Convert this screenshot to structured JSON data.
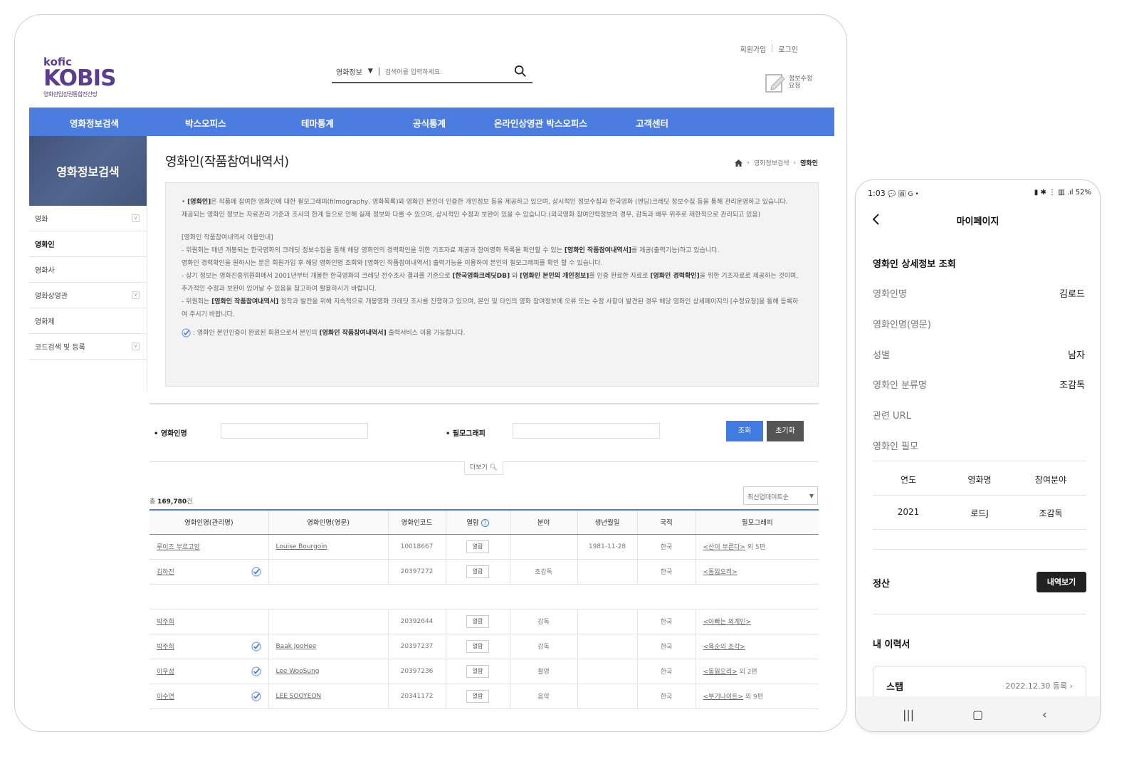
{
  "tablet": {
    "logo": {
      "brand": "kofic",
      "name": "KOBIS",
      "sub": "영화관입장권통합전산망"
    },
    "search": {
      "category": "영화정보",
      "placeholder": "검색어를 입력하세요."
    },
    "top_links": {
      "join": "회원가입",
      "login": "로그인"
    },
    "edit_request": "정보수정 요청",
    "gnb": [
      "영화정보검색",
      "박스오피스",
      "테마통계",
      "공식통계",
      "온라인상영관 박스오피스",
      "고객센터"
    ],
    "lnb": {
      "title": "영화정보검색",
      "items": [
        {
          "label": "영화",
          "chev": true
        },
        {
          "label": "영화인",
          "chev": false
        },
        {
          "label": "영화사",
          "chev": false
        },
        {
          "label": "영화상영관",
          "chev": true
        },
        {
          "label": "영화제",
          "chev": false
        },
        {
          "label": "코드검색 및 등록",
          "chev": true
        }
      ]
    },
    "page_title": "영화인(작품참여내역서)",
    "breadcrumb": {
      "level1": "영화정보검색",
      "current": "영화인"
    },
    "info": {
      "p1_b": "[영화인]",
      "p1": "은 작품에 참여한 영화인에 대한 필모그래피(filmography, 영화목록)와 영화인 본인이 인증한 개인정보 등을 제공하고 있으며, 상시적인 정보수집과 한국영화 (엔딩)크레딧 정보수집 등을 통해 관리운영하고 있습니다.",
      "p2": "제공되는 영화인 정보는 자료관리 기준과 조사의 한계 등으로 인해 실제 정보와 다를 수 있으며, 상시적인 수정과 보완이 있을 수 있습니다.(외국영화 참여인력정보의 경우, 감독과 배우 위주로 제한적으로 관리되고 있음)",
      "p3": "[영화인 작품참여내역서 이용안내]",
      "p4a": "위원회는 매년 개봉되는 한국영화의 크레딧 정보수집을 통해 해당 영화인의 경력확인을 위한 기초자료 제공과 참여영화 목록을 확인할 수 있는 ",
      "p4b": "[영화인 작품참여내역서]",
      "p4c": "를 제공(출력기능)하고 있습니다.",
      "p5": "영화인 경력확인을 원하시는 분은 회원가입 후 해당 영화인명 조회와 [영화인 작품참여내역서] 출력기능을 이용하여 본인의 필모그래피를 확인 할 수 있습니다.",
      "p6a": "상기 정보는 영화진흥위원회에서 2001년부터 개봉한 한국영화의 크레딧 전수조사 결과를 기준으로 ",
      "p6b": "[한국영화크레딧DB]",
      "p6c": " 와 ",
      "p6d": "[영화인 본인의 개인정보]",
      "p6e": "를 인증 완료한 자료로 ",
      "p6f": "[영화인 경력확인]",
      "p6g": "을 위한 기초자료로 제공하는 것이며, 추가적인 수정과 보완이 있어날 수 있음을 참고하여 활용하시기 바랍니다.",
      "p7a": "위원회는 ",
      "p7b": "[영화인 작품참여내역서]",
      "p7c": " 정착과 발전을 위해 지속적으로 개봉영화 크레딧 조사를 진행하고 있으며, 본인 및 타인의 영화 참여정보에 오류 또는 수정 사항이 발견된 경우 해당 영화인 상세페이지의 [수정요청]을 통해 등록하여 주시기 바랍니다.",
      "p8a": ": 영화인 본인인증이 완료된 회원으로서 본인의 ",
      "p8b": "[영화인 작품참여내역서]",
      "p8c": " 출력서비스 이용 가능합니다."
    },
    "filter": {
      "name_label": "영화인명",
      "filmo_label": "필모그래피",
      "search_btn": "조회",
      "reset_btn": "초기화",
      "more": "더보기"
    },
    "total": {
      "prefix": "총 ",
      "count": "169,780",
      "suffix": "건"
    },
    "sort": "최신업데이트순",
    "table": {
      "headers": [
        "영화인명(관리명)",
        "영화인명(영문)",
        "영화인코드",
        "열람",
        "분야",
        "생년월일",
        "국적",
        "필모그래피"
      ],
      "view_label": "열람",
      "rows": [
        {
          "name": "루이즈 부르고앙",
          "verified": false,
          "en": "Louise Bourgoin",
          "code": "10018667",
          "field": "",
          "birth": "1981-11-28",
          "nation": "한국",
          "filmo": "<산이 부른다>",
          "filmo_more": " 외 5편"
        },
        {
          "name": "김하진",
          "verified": true,
          "en": "",
          "code": "20397272",
          "field": "조감독",
          "birth": "",
          "nation": "한국",
          "filmo": "<동잃오리>",
          "filmo_more": ""
        },
        {
          "name": "박주희",
          "verified": false,
          "en": "",
          "code": "20392644",
          "field": "감독",
          "birth": "",
          "nation": "한국",
          "filmo": "<아빠는 외계인>",
          "filmo_more": ""
        },
        {
          "name": "박주희",
          "verified": true,
          "en": "Baak JooHee",
          "code": "20397237",
          "field": "감독",
          "birth": "",
          "nation": "한국",
          "filmo": "<욕순의 조각>",
          "filmo_more": ""
        },
        {
          "name": "이우성",
          "verified": true,
          "en": "Lee WooSung",
          "code": "20397236",
          "field": "촬영",
          "birth": "",
          "nation": "한국",
          "filmo": "<동잃오리>",
          "filmo_more": " 외 2편"
        },
        {
          "name": "이수연",
          "verified": true,
          "en": "LEE SOOYEON",
          "code": "20341172",
          "field": "음악",
          "birth": "",
          "nation": "한국",
          "filmo": "<부기나이트>",
          "filmo_more": " 외 9편"
        }
      ]
    }
  },
  "phone": {
    "status_time": "1:03",
    "status_icons": "💬 🖼 G •",
    "status_right": "52%",
    "title": "마이페이지",
    "section1": "영화인 상세정보 조회",
    "fields": [
      {
        "label": "영화인명",
        "value": "김로드"
      },
      {
        "label": "영화인명(영문)",
        "value": ""
      },
      {
        "label": "성별",
        "value": "남자"
      },
      {
        "label": "영화인 분류명",
        "value": "조감독"
      },
      {
        "label": "관련 URL",
        "value": ""
      },
      {
        "label": "영화인 필모",
        "value": ""
      }
    ],
    "filmo_headers": [
      "연도",
      "영화명",
      "참여분야"
    ],
    "filmo_row": [
      "2021",
      "로드J",
      "조감독"
    ],
    "settle_label": "정산",
    "settle_btn": "내역보기",
    "resume_label": "내 이력서",
    "resume_card": {
      "name": "스탭",
      "date": "2022.12.30 등록"
    }
  },
  "colors": {
    "accent_blue": "#4b7de0",
    "logo_purple": "#5a3d8f",
    "button_gray": "#555555"
  }
}
